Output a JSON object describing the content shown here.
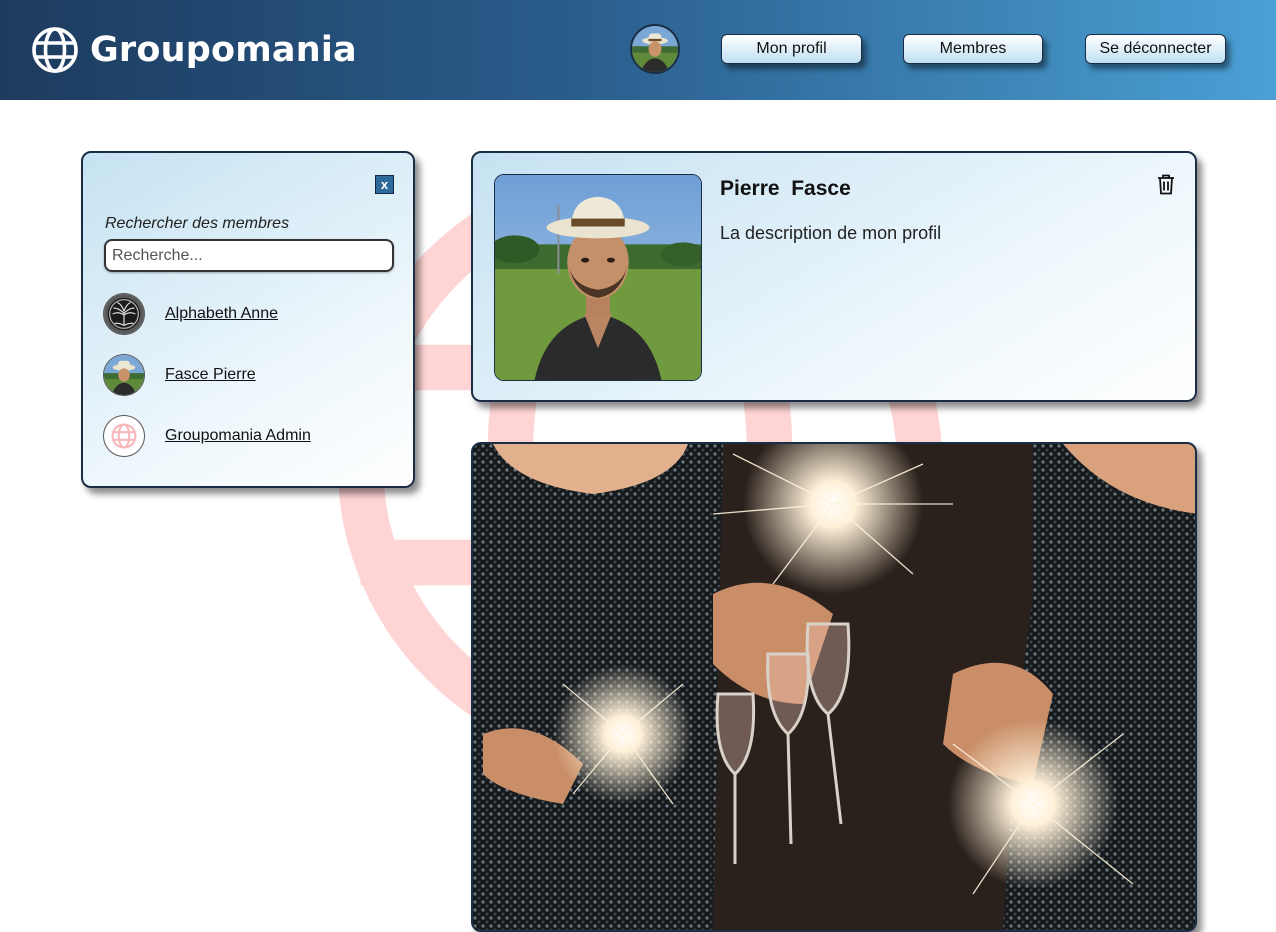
{
  "header": {
    "brand": "Groupomania",
    "logo_icon": "globe-icon",
    "nav": {
      "profile_label": "Mon profil",
      "members_label": "Membres",
      "logout_label": "Se déconnecter"
    },
    "colors": {
      "gradient_start": "#1d3b5e",
      "gradient_end": "#4aa0d5"
    }
  },
  "search_panel": {
    "close_label": "x",
    "title": "Rechercher des membres",
    "placeholder": "Recherche...",
    "members": [
      {
        "name": "Alphabeth Anne",
        "avatar": "tree-of-life-avatar"
      },
      {
        "name": "Fasce Pierre",
        "avatar": "person-hat-avatar"
      },
      {
        "name": "Groupomania Admin",
        "avatar": "globe-logo-avatar"
      }
    ]
  },
  "profile": {
    "first_name": "Pierre",
    "last_name": "Fasce",
    "description": "La description de mon profil",
    "delete_icon": "trash-icon"
  },
  "post": {
    "image": "celebration-sparklers-champagne-image"
  },
  "colors": {
    "card_border": "#1b2d45",
    "watermark": "#ff0000"
  }
}
